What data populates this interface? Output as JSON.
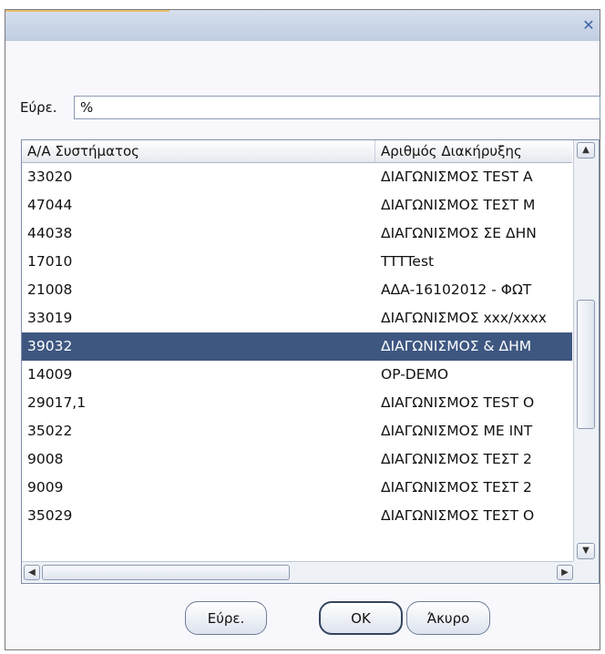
{
  "dialog": {
    "close_icon_glyph": "✕"
  },
  "search": {
    "label": "Εύρε.",
    "value": "%"
  },
  "table": {
    "headers": [
      "Α/Α Συστήματος",
      "Αριθμός Διακήρυξης"
    ],
    "rows": [
      [
        "33020",
        "ΔΙΑΓΩΝΙΣΜΟΣ TEST Α"
      ],
      [
        "47044",
        "ΔΙΑΓΩΝΙΣΜΟΣ ΤΕΣΤ Μ"
      ],
      [
        "44038",
        "ΔΙΑΓΩΝΙΣΜΟΣ ΣΕ ΔΗΝ"
      ],
      [
        "17010",
        "TTTTest"
      ],
      [
        "21008",
        "ΑΔΑ-16102012 - ΦΩΤ"
      ],
      [
        "33019",
        "ΔΙΑΓΩΝΙΣΜΟΣ xxx/xxxx"
      ],
      [
        "39032",
        "ΔΙΑΓΩΝΙΣΜΟΣ & ΔΗΜ"
      ],
      [
        "14009",
        "OP-DEMO"
      ],
      [
        "29017,1",
        "ΔΙΑΓΩΝΙΣΜΟΣ TEST Ο"
      ],
      [
        "35022",
        "ΔΙΑΓΩΝΙΣΜΟΣ ΜΕ ΙΝΤ"
      ],
      [
        "9008",
        "ΔΙΑΓΩΝΙΣΜΟΣ ΤΕΣΤ 2"
      ],
      [
        "9009",
        "ΔΙΑΓΩΝΙΣΜΟΣ ΤΕΣΤ 2"
      ],
      [
        "35029",
        "ΔΙΑΓΩΝΙΣΜΟΣ ΤΕΣΤ Ο"
      ]
    ],
    "selected_index": 6,
    "scroll": {
      "up_glyph": "▲",
      "down_glyph": "▼",
      "left_glyph": "◀",
      "right_glyph": "▶"
    }
  },
  "buttons": {
    "find": "Εύρε.",
    "ok": "OK",
    "cancel": "Άκυρο"
  },
  "colors": {
    "selected_row": "#3e5781",
    "title_bar": "#c8d4e8",
    "close_icon": "#3d63a6"
  }
}
